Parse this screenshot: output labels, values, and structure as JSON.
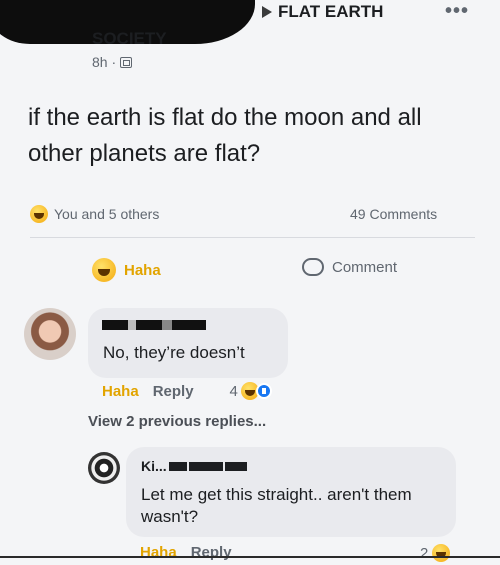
{
  "post": {
    "group_name": "FLAT EARTH",
    "author_suffix": "SOCIETY",
    "time": "8h ·",
    "more_icon": "more-dots-icon",
    "text": "if the earth is flat do the moon and all other planets are flat?"
  },
  "reactions": {
    "summary": "You and 5 others",
    "comments": "49 Comments"
  },
  "actions": {
    "haha": "Haha",
    "comment": "Comment"
  },
  "comment1": {
    "text": "No, they’re doesn’t",
    "haha_label": "Haha",
    "reply_label": "Reply",
    "reaction_count": "4"
  },
  "view_previous": "View 2 previous replies...",
  "comment2": {
    "name_visible": "Ki...",
    "text": "Let me get this straight.. aren't them wasn't?",
    "haha_label": "Haha",
    "reply_label": "Reply",
    "reaction_count": "2"
  },
  "colors": {
    "haha_yellow": "#e2a400",
    "like_blue": "#1877f2",
    "bubble_bg": "#e9eaee"
  }
}
